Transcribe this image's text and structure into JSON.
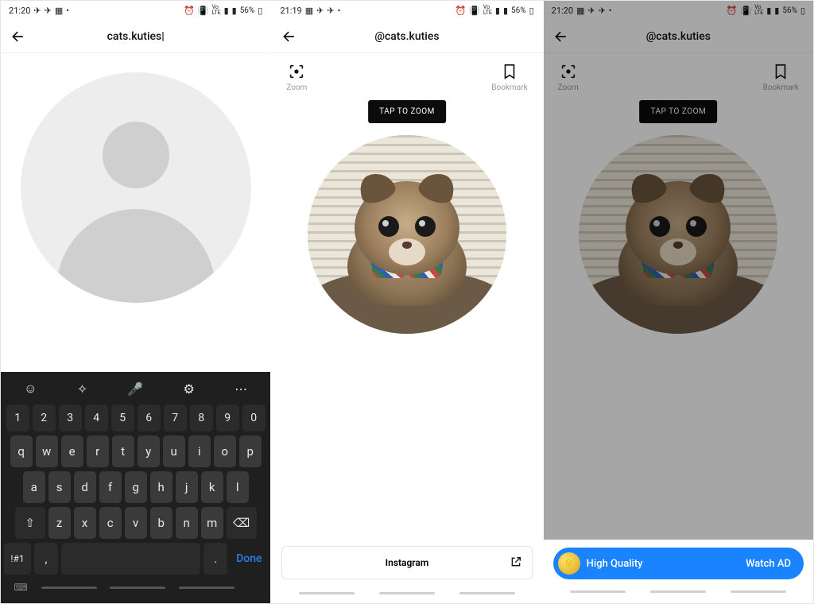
{
  "status": {
    "left_icons": [
      "paper-plane-icon",
      "paper-plane-icon",
      "image-icon",
      "dot-icon"
    ],
    "right_icons": [
      "alarm-icon",
      "vibrate-icon",
      "volte-icon",
      "signal-icon",
      "signal-icon",
      "battery-icon"
    ],
    "battery": "56%"
  },
  "screen1": {
    "time": "21:20",
    "search_value": "cats.kuties",
    "keyboard": {
      "top_icons": [
        "emoji-icon",
        "sticker-icon",
        "mic-icon",
        "gear-icon",
        "more-icon"
      ],
      "row_numbers": [
        "1",
        "2",
        "3",
        "4",
        "5",
        "6",
        "7",
        "8",
        "9",
        "0"
      ],
      "row_q": [
        "q",
        "w",
        "e",
        "r",
        "t",
        "y",
        "u",
        "i",
        "o",
        "p"
      ],
      "row_a": [
        "a",
        "s",
        "d",
        "f",
        "g",
        "h",
        "j",
        "k",
        "l"
      ],
      "row_z": [
        "z",
        "x",
        "c",
        "v",
        "b",
        "n",
        "m"
      ],
      "shift": "⇧",
      "backspace": "⌫",
      "symbols": "!#1",
      "comma": ",",
      "period": ".",
      "done": "Done"
    }
  },
  "screen2": {
    "time": "21:19",
    "title": "@cats.kuties",
    "zoom_label": "Zoom",
    "bookmark_label": "Bookmark",
    "tooltip": "TAP TO ZOOM",
    "instagram_button": "Instagram"
  },
  "screen3": {
    "time": "21:20",
    "title": "@cats.kuties",
    "zoom_label": "Zoom",
    "bookmark_label": "Bookmark",
    "tooltip": "TAP TO ZOOM",
    "hq_label": "High Quality",
    "watch_ad": "Watch AD"
  }
}
